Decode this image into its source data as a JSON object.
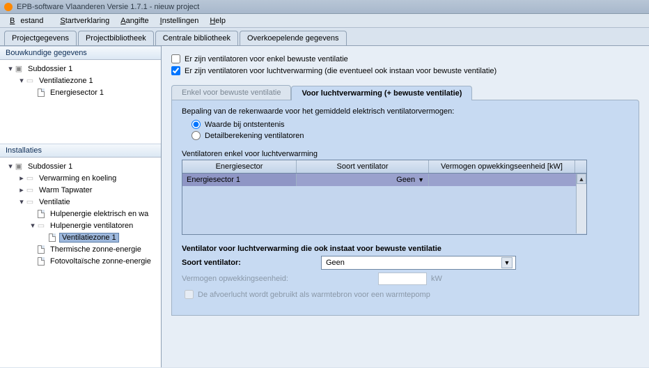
{
  "title": "EPB-software Vlaanderen Versie 1.7.1 - nieuw project",
  "menu": {
    "bestand": "Bestand",
    "startverklaring": "Startverklaring",
    "aangifte": "Aangifte",
    "instellingen": "Instellingen",
    "help": "Help"
  },
  "main_tabs": {
    "t1": "Projectgegevens",
    "t2": "Projectbibliotheek",
    "t3": "Centrale bibliotheek",
    "t4": "Overkoepelende gegevens"
  },
  "left_panel1_title": "Bouwkundige gegevens",
  "left_panel2_title": "Installaties",
  "tree1": {
    "subdossier": "Subdossier 1",
    "ventzone": "Ventilatiezone 1",
    "energiesector": "Energiesector 1"
  },
  "tree2": {
    "subdossier": "Subdossier 1",
    "verwarming": "Verwarming en koeling",
    "warm": "Warm Tapwater",
    "ventilatie": "Ventilatie",
    "hulpelek": "Hulpenergie elektrisch en wa",
    "hulpvent": "Hulpenergie ventilatoren",
    "ventzone": "Ventilatiezone 1",
    "thermische": "Thermische zonne-energie",
    "foto": "Fotovoltaïsche zonne-energie"
  },
  "chk1": "Er zijn ventilatoren voor enkel bewuste ventilatie",
  "chk2": "Er zijn ventilatoren voor luchtverwarming (die eventueel ook instaan voor bewuste ventilatie)",
  "subtab1": "Enkel voor bewuste ventilatie",
  "subtab2": "Voor luchtverwarming (+ bewuste ventilatie)",
  "heading": "Bepaling van de rekenwaarde voor het gemiddeld elektrisch ventilatorvermogen:",
  "radio1": "Waarde bij ontstentenis",
  "radio2": "Detailberekening ventilatoren",
  "section_title": "Ventilatoren enkel voor luchtverwarming",
  "th1": "Energiesector",
  "th2": "Soort ventilator",
  "th3": "Vermogen opwekkingseenheid [kW]",
  "row_es": "Energiesector 1",
  "row_soort": "Geen",
  "section2_title": "Ventilator voor luchtverwarming die ook instaat voor bewuste ventilatie",
  "form_soort_label": "Soort ventilator:",
  "form_soort_value": "Geen",
  "form_verm_label": "Vermogen opwekkingseenheid:",
  "form_verm_unit": "kW",
  "chk3": "De afvoerlucht wordt gebruikt als warmtebron voor een warmtepomp"
}
